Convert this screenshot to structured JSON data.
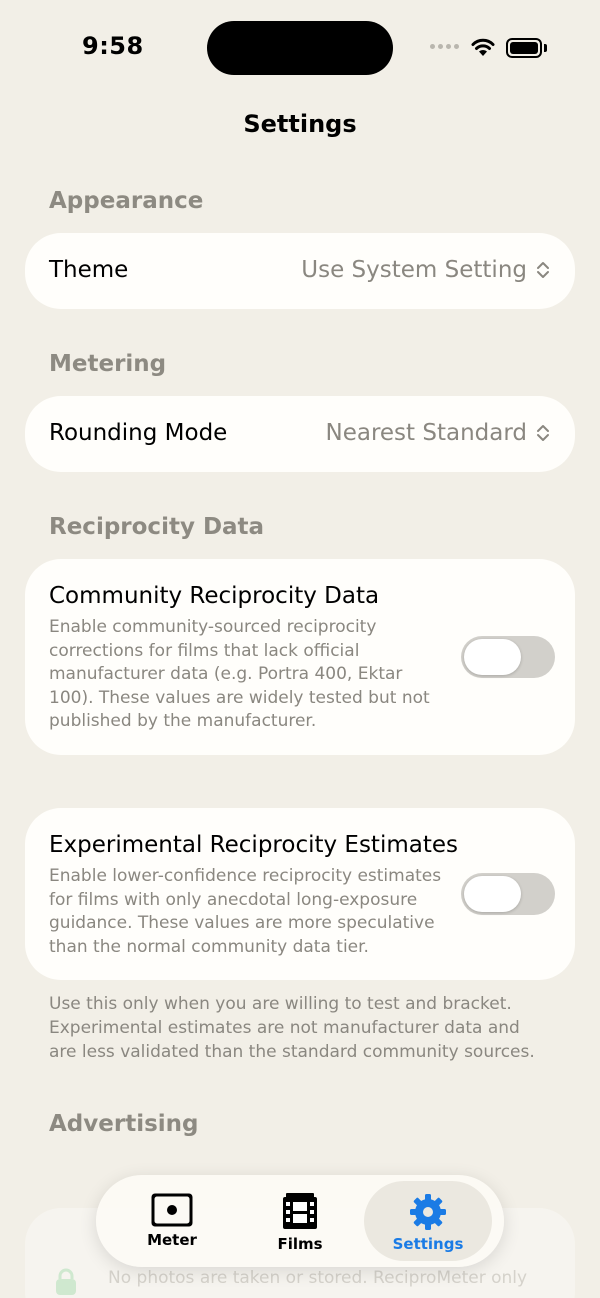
{
  "status_bar": {
    "time": "9:58"
  },
  "nav": {
    "title": "Settings"
  },
  "appearance": {
    "header": "Appearance",
    "theme_label": "Theme",
    "theme_value": "Use System Setting"
  },
  "metering": {
    "header": "Metering",
    "rounding_label": "Rounding Mode",
    "rounding_value": "Nearest Standard"
  },
  "reciprocity": {
    "header": "Reciprocity Data",
    "community": {
      "title": "Community Reciprocity Data",
      "description": "Enable community-sourced reciprocity corrections for films that lack official manufacturer data (e.g. Portra 400, Ektar 100). These values are widely tested but not published by the manufacturer.",
      "enabled": false
    },
    "experimental": {
      "title": "Experimental Reciprocity Estimates",
      "description": "Enable lower-confidence reciprocity estimates for films with only anecdotal long-exposure guidance. These values are more speculative than the normal community data tier.",
      "enabled": false
    },
    "footnote": "Use this only when you are willing to test and bracket. Experimental estimates are not manufacturer data and are less validated than the standard community sources."
  },
  "advertising": {
    "header": "Advertising",
    "partial_text": "No photos are taken or stored. ReciproMeter only"
  },
  "tabs": [
    {
      "label": "Meter",
      "icon": "meter-icon",
      "active": false
    },
    {
      "label": "Films",
      "icon": "film-icon",
      "active": false
    },
    {
      "label": "Settings",
      "icon": "gear-icon",
      "active": true
    }
  ],
  "colors": {
    "accent": "#1a7be5",
    "background": "#f2efe7",
    "card": "#fffefb",
    "secondary_text": "#8a8780"
  }
}
